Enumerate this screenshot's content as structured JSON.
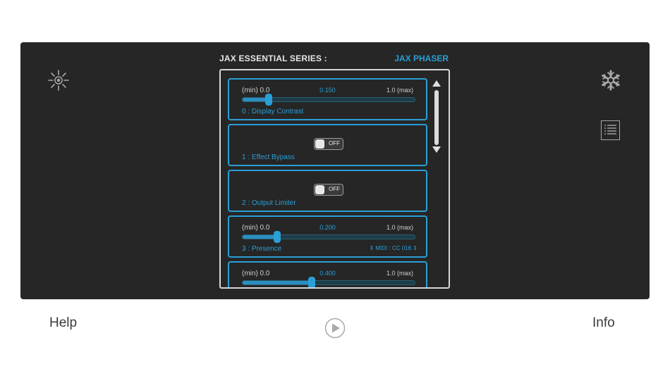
{
  "header": {
    "series": "JAX ESSENTIAL SERIES :",
    "effect": "JAX PHASER"
  },
  "params": [
    {
      "type": "slider",
      "min_label": "(min) 0.0",
      "value_label": "0.150",
      "max_label": "1.0  (max)",
      "name": "0 : Display Contrast",
      "fraction": 0.15
    },
    {
      "type": "toggle",
      "state": "OFF",
      "name": "1 : Effect Bypass"
    },
    {
      "type": "toggle",
      "state": "OFF",
      "name": "2 : Output Limiter"
    },
    {
      "type": "slider",
      "min_label": "(min) 0.0",
      "value_label": "0.200",
      "max_label": "1.0  (max)",
      "name": "3 : Presence",
      "midi": "⇕ MIDI : CC 016 ⇕",
      "fraction": 0.2
    },
    {
      "type": "slider",
      "min_label": "(min) 0.0",
      "value_label": "0.400",
      "max_label": "1.0  (max)",
      "fraction": 0.4
    }
  ],
  "icons": {
    "left": "sun-icon",
    "right_top": "snowflake-icon",
    "right_bottom": "list-icon",
    "center": "play-icon"
  },
  "footer": {
    "help": "Help",
    "info": "Info"
  },
  "colors": {
    "accent": "#2a9fd6",
    "panel": "#262626"
  }
}
